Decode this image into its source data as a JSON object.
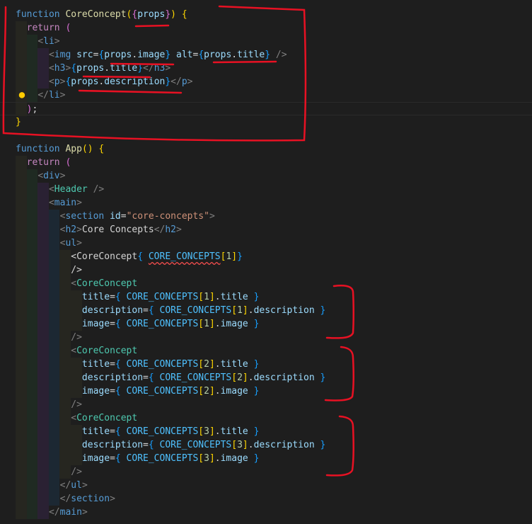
{
  "editor": {
    "lines": [
      [
        {
          "t": "function ",
          "c": "kw"
        },
        {
          "t": "CoreConcept",
          "c": "fn"
        },
        {
          "t": "(",
          "c": "p1"
        },
        {
          "t": "{",
          "c": "p2"
        },
        {
          "t": "props",
          "c": "var"
        },
        {
          "t": "}",
          "c": "p2"
        },
        {
          "t": ")",
          "c": "p1"
        },
        {
          "t": " "
        },
        {
          "t": "{",
          "c": "p1"
        }
      ],
      [
        {
          "t": "  "
        },
        {
          "t": "return",
          "c": "ctl"
        },
        {
          "t": " "
        },
        {
          "t": "(",
          "c": "p2"
        }
      ],
      [
        {
          "t": "    "
        },
        {
          "t": "<",
          "c": "br"
        },
        {
          "t": "li",
          "c": "tag"
        },
        {
          "t": ">",
          "c": "br"
        }
      ],
      [
        {
          "t": "      "
        },
        {
          "t": "<",
          "c": "br"
        },
        {
          "t": "img",
          "c": "tag"
        },
        {
          "t": " "
        },
        {
          "t": "src",
          "c": "attr"
        },
        {
          "t": "=",
          "c": "op"
        },
        {
          "t": "{",
          "c": "p3"
        },
        {
          "t": "props",
          "c": "var"
        },
        {
          "t": "."
        },
        {
          "t": "image",
          "c": "var"
        },
        {
          "t": "}",
          "c": "p3"
        },
        {
          "t": " "
        },
        {
          "t": "alt",
          "c": "attr"
        },
        {
          "t": "=",
          "c": "op"
        },
        {
          "t": "{",
          "c": "p3"
        },
        {
          "t": "props",
          "c": "var"
        },
        {
          "t": "."
        },
        {
          "t": "title",
          "c": "var"
        },
        {
          "t": "}",
          "c": "p3"
        },
        {
          "t": " "
        },
        {
          "t": "/>",
          "c": "br"
        }
      ],
      [
        {
          "t": "      "
        },
        {
          "t": "<",
          "c": "br"
        },
        {
          "t": "h3",
          "c": "tag"
        },
        {
          "t": ">",
          "c": "br"
        },
        {
          "t": "{",
          "c": "p3"
        },
        {
          "t": "props",
          "c": "var"
        },
        {
          "t": "."
        },
        {
          "t": "title",
          "c": "var"
        },
        {
          "t": "}",
          "c": "p3"
        },
        {
          "t": "</",
          "c": "br"
        },
        {
          "t": "h3",
          "c": "tag"
        },
        {
          "t": ">",
          "c": "br"
        }
      ],
      [
        {
          "t": "      "
        },
        {
          "t": "<",
          "c": "br"
        },
        {
          "t": "p",
          "c": "tag"
        },
        {
          "t": ">",
          "c": "br"
        },
        {
          "t": "{",
          "c": "p3"
        },
        {
          "t": "props",
          "c": "var"
        },
        {
          "t": "."
        },
        {
          "t": "description",
          "c": "var"
        },
        {
          "t": "}",
          "c": "p3"
        },
        {
          "t": "</",
          "c": "br"
        },
        {
          "t": "p",
          "c": "tag"
        },
        {
          "t": ">",
          "c": "br"
        }
      ],
      [
        {
          "t": "    "
        },
        {
          "t": "</",
          "c": "br"
        },
        {
          "t": "li",
          "c": "tag"
        },
        {
          "t": ">",
          "c": "br"
        }
      ],
      [
        {
          "t": "  "
        },
        {
          "t": ")",
          "c": "p2"
        },
        {
          "t": ";"
        }
      ],
      [
        {
          "t": "}",
          "c": "p1"
        }
      ],
      [],
      [
        {
          "t": "function ",
          "c": "kw"
        },
        {
          "t": "App",
          "c": "fn"
        },
        {
          "t": "(",
          "c": "p1"
        },
        {
          "t": ")",
          "c": "p1"
        },
        {
          "t": " "
        },
        {
          "t": "{",
          "c": "p1"
        }
      ],
      [
        {
          "t": "  "
        },
        {
          "t": "return",
          "c": "ctl"
        },
        {
          "t": " "
        },
        {
          "t": "(",
          "c": "p2"
        }
      ],
      [
        {
          "t": "    "
        },
        {
          "t": "<",
          "c": "br"
        },
        {
          "t": "div",
          "c": "tag"
        },
        {
          "t": ">",
          "c": "br"
        }
      ],
      [
        {
          "t": "      "
        },
        {
          "t": "<",
          "c": "br"
        },
        {
          "t": "Header",
          "c": "comp"
        },
        {
          "t": " "
        },
        {
          "t": "/>",
          "c": "br"
        }
      ],
      [
        {
          "t": "      "
        },
        {
          "t": "<",
          "c": "br"
        },
        {
          "t": "main",
          "c": "tag"
        },
        {
          "t": ">",
          "c": "br"
        }
      ],
      [
        {
          "t": "        "
        },
        {
          "t": "<",
          "c": "br"
        },
        {
          "t": "section",
          "c": "tag"
        },
        {
          "t": " "
        },
        {
          "t": "id",
          "c": "attr"
        },
        {
          "t": "=",
          "c": "op"
        },
        {
          "t": "\"core-concepts\"",
          "c": "str"
        },
        {
          "t": ">",
          "c": "br"
        }
      ],
      [
        {
          "t": "        "
        },
        {
          "t": "<",
          "c": "br"
        },
        {
          "t": "h2",
          "c": "tag"
        },
        {
          "t": ">",
          "c": "br"
        },
        {
          "t": "Core Concepts"
        },
        {
          "t": "</",
          "c": "br"
        },
        {
          "t": "h2",
          "c": "tag"
        },
        {
          "t": ">",
          "c": "br"
        }
      ],
      [
        {
          "t": "        "
        },
        {
          "t": "<",
          "c": "br"
        },
        {
          "t": "ul",
          "c": "tag"
        },
        {
          "t": ">",
          "c": "br"
        }
      ],
      [
        {
          "t": "          "
        },
        {
          "t": "<CoreConcept"
        },
        {
          "t": "{",
          "c": "p3"
        },
        {
          "t": " "
        },
        {
          "t": "CORE_CONCEPTS",
          "c": "const",
          "s": 1
        },
        {
          "t": "[",
          "c": "p1"
        },
        {
          "t": "1",
          "c": "num"
        },
        {
          "t": "]",
          "c": "p1"
        },
        {
          "t": "}",
          "c": "p3"
        }
      ],
      [
        {
          "t": "          "
        },
        {
          "t": "/>"
        }
      ],
      [
        {
          "t": "          "
        },
        {
          "t": "<",
          "c": "br"
        },
        {
          "t": "CoreConcept",
          "c": "comp"
        }
      ],
      [
        {
          "t": "            "
        },
        {
          "t": "title",
          "c": "attr"
        },
        {
          "t": "=",
          "c": "op"
        },
        {
          "t": "{",
          "c": "p3"
        },
        {
          "t": " "
        },
        {
          "t": "CORE_CONCEPTS",
          "c": "const"
        },
        {
          "t": "[",
          "c": "p1"
        },
        {
          "t": "1",
          "c": "num"
        },
        {
          "t": "]",
          "c": "p1"
        },
        {
          "t": "."
        },
        {
          "t": "title",
          "c": "var"
        },
        {
          "t": " "
        },
        {
          "t": "}",
          "c": "p3"
        }
      ],
      [
        {
          "t": "            "
        },
        {
          "t": "description",
          "c": "attr"
        },
        {
          "t": "=",
          "c": "op"
        },
        {
          "t": "{",
          "c": "p3"
        },
        {
          "t": " "
        },
        {
          "t": "CORE_CONCEPTS",
          "c": "const"
        },
        {
          "t": "[",
          "c": "p1"
        },
        {
          "t": "1",
          "c": "num"
        },
        {
          "t": "]",
          "c": "p1"
        },
        {
          "t": "."
        },
        {
          "t": "description",
          "c": "var"
        },
        {
          "t": " "
        },
        {
          "t": "}",
          "c": "p3"
        }
      ],
      [
        {
          "t": "            "
        },
        {
          "t": "image",
          "c": "attr"
        },
        {
          "t": "=",
          "c": "op"
        },
        {
          "t": "{",
          "c": "p3"
        },
        {
          "t": " "
        },
        {
          "t": "CORE_CONCEPTS",
          "c": "const"
        },
        {
          "t": "[",
          "c": "p1"
        },
        {
          "t": "1",
          "c": "num"
        },
        {
          "t": "]",
          "c": "p1"
        },
        {
          "t": "."
        },
        {
          "t": "image",
          "c": "var"
        },
        {
          "t": " "
        },
        {
          "t": "}",
          "c": "p3"
        }
      ],
      [
        {
          "t": "          "
        },
        {
          "t": "/>",
          "c": "br"
        }
      ],
      [
        {
          "t": "          "
        },
        {
          "t": "<",
          "c": "br"
        },
        {
          "t": "CoreConcept",
          "c": "comp"
        }
      ],
      [
        {
          "t": "            "
        },
        {
          "t": "title",
          "c": "attr"
        },
        {
          "t": "=",
          "c": "op"
        },
        {
          "t": "{",
          "c": "p3"
        },
        {
          "t": " "
        },
        {
          "t": "CORE_CONCEPTS",
          "c": "const"
        },
        {
          "t": "[",
          "c": "p1"
        },
        {
          "t": "2",
          "c": "num"
        },
        {
          "t": "]",
          "c": "p1"
        },
        {
          "t": "."
        },
        {
          "t": "title",
          "c": "var"
        },
        {
          "t": " "
        },
        {
          "t": "}",
          "c": "p3"
        }
      ],
      [
        {
          "t": "            "
        },
        {
          "t": "description",
          "c": "attr"
        },
        {
          "t": "=",
          "c": "op"
        },
        {
          "t": "{",
          "c": "p3"
        },
        {
          "t": " "
        },
        {
          "t": "CORE_CONCEPTS",
          "c": "const"
        },
        {
          "t": "[",
          "c": "p1"
        },
        {
          "t": "2",
          "c": "num"
        },
        {
          "t": "]",
          "c": "p1"
        },
        {
          "t": "."
        },
        {
          "t": "description",
          "c": "var"
        },
        {
          "t": " "
        },
        {
          "t": "}",
          "c": "p3"
        }
      ],
      [
        {
          "t": "            "
        },
        {
          "t": "image",
          "c": "attr"
        },
        {
          "t": "=",
          "c": "op"
        },
        {
          "t": "{",
          "c": "p3"
        },
        {
          "t": " "
        },
        {
          "t": "CORE_CONCEPTS",
          "c": "const"
        },
        {
          "t": "[",
          "c": "p1"
        },
        {
          "t": "2",
          "c": "num"
        },
        {
          "t": "]",
          "c": "p1"
        },
        {
          "t": "."
        },
        {
          "t": "image",
          "c": "var"
        },
        {
          "t": " "
        },
        {
          "t": "}",
          "c": "p3"
        }
      ],
      [
        {
          "t": "          "
        },
        {
          "t": "/>",
          "c": "br"
        }
      ],
      [
        {
          "t": "          "
        },
        {
          "t": "<",
          "c": "br"
        },
        {
          "t": "CoreConcept",
          "c": "comp"
        }
      ],
      [
        {
          "t": "            "
        },
        {
          "t": "title",
          "c": "attr"
        },
        {
          "t": "=",
          "c": "op"
        },
        {
          "t": "{",
          "c": "p3"
        },
        {
          "t": " "
        },
        {
          "t": "CORE_CONCEPTS",
          "c": "const"
        },
        {
          "t": "[",
          "c": "p1"
        },
        {
          "t": "3",
          "c": "num"
        },
        {
          "t": "]",
          "c": "p1"
        },
        {
          "t": "."
        },
        {
          "t": "title",
          "c": "var"
        },
        {
          "t": " "
        },
        {
          "t": "}",
          "c": "p3"
        }
      ],
      [
        {
          "t": "            "
        },
        {
          "t": "description",
          "c": "attr"
        },
        {
          "t": "=",
          "c": "op"
        },
        {
          "t": "{",
          "c": "p3"
        },
        {
          "t": " "
        },
        {
          "t": "CORE_CONCEPTS",
          "c": "const"
        },
        {
          "t": "[",
          "c": "p1"
        },
        {
          "t": "3",
          "c": "num"
        },
        {
          "t": "]",
          "c": "p1"
        },
        {
          "t": "."
        },
        {
          "t": "description",
          "c": "var"
        },
        {
          "t": " "
        },
        {
          "t": "}",
          "c": "p3"
        }
      ],
      [
        {
          "t": "            "
        },
        {
          "t": "image",
          "c": "attr"
        },
        {
          "t": "=",
          "c": "op"
        },
        {
          "t": "{",
          "c": "p3"
        },
        {
          "t": " "
        },
        {
          "t": "CORE_CONCEPTS",
          "c": "const"
        },
        {
          "t": "[",
          "c": "p1"
        },
        {
          "t": "3",
          "c": "num"
        },
        {
          "t": "]",
          "c": "p1"
        },
        {
          "t": "."
        },
        {
          "t": "image",
          "c": "var"
        },
        {
          "t": " "
        },
        {
          "t": "}",
          "c": "p3"
        }
      ],
      [
        {
          "t": "          "
        },
        {
          "t": "/>",
          "c": "br"
        }
      ],
      [
        {
          "t": "        "
        },
        {
          "t": "</",
          "c": "br"
        },
        {
          "t": "ul",
          "c": "tag"
        },
        {
          "t": ">",
          "c": "br"
        }
      ],
      [
        {
          "t": "        "
        },
        {
          "t": "</",
          "c": "br"
        },
        {
          "t": "section",
          "c": "tag"
        },
        {
          "t": ">",
          "c": "br"
        }
      ],
      [
        {
          "t": "      "
        },
        {
          "t": "</",
          "c": "br"
        },
        {
          "t": "main",
          "c": "tag"
        },
        {
          "t": ">",
          "c": "br"
        }
      ]
    ]
  },
  "icons": {
    "lightbulb": "lightbulb-icon"
  },
  "annotation_color": "#e81123"
}
